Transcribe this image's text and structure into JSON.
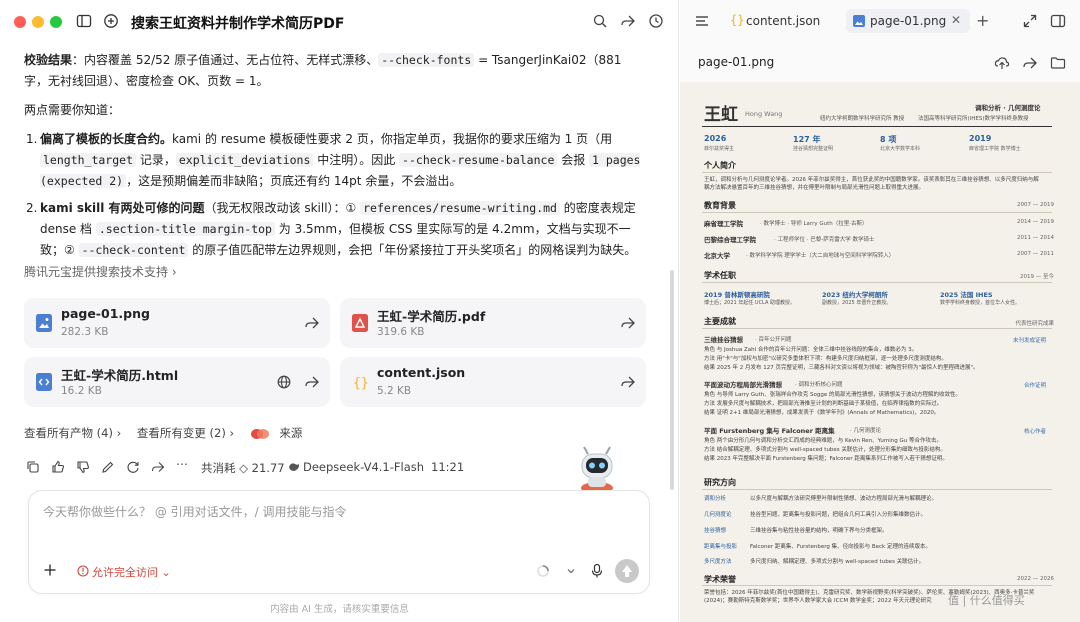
{
  "window": {
    "title": "搜索王虹资料并制作学术简历PDF"
  },
  "chat": {
    "verify_label": "校验结果",
    "verify_text_1": "：内容覆盖 52/52 原子值通过、无占位符、无样式漂移、",
    "verify_code": "--check-fonts",
    "verify_text_2": " = TsangerJinKai02（881 字，无衬线回退）、密度检查 OK、页数 = 1。",
    "intro": "两点需要你知道：",
    "item1_num": "1.",
    "item1_title": "偏离了模板的长度合约。",
    "item1_a": "kami 的 resume 模板硬性要求 2 页，你指定单页，我据你的要求压缩为 1 页（用",
    "item1_code1": "length_target",
    "item1_b": " 记录，",
    "item1_code2": "explicit_deviations",
    "item1_c": " 中注明）。因此 ",
    "item1_code3": "--check-resume-balance",
    "item1_d": " 会报 ",
    "item1_code4": "1 pages (expected 2)",
    "item1_e": "，这是预期偏差而非缺陷；页底还有约 14pt 余量，不会溢出。",
    "item2_num": "2.",
    "item2_title": "kami skill 有两处可修的问题",
    "item2_a": "（我无权限改动该 skill）：① ",
    "item2_code1": "references/resume-writing.md",
    "item2_b": " 的密度表规定 dense 档 ",
    "item2_code2": ".section-title margin-top",
    "item2_c": " 为 3.5mm，但模板 CSS 里实际写的是 4.2mm，文档与实现不一致；② ",
    "item2_code3": "--check-content",
    "item2_d": " 的原子值匹配带左边界规则，会把「年份紧接拉丁开头奖项名」的网格误判为缺失。",
    "source": "腾讯元宝提供搜索技术支持 ›"
  },
  "files": [
    {
      "name": "page-01.png",
      "size": "282.3 KB",
      "icon": "image-icon",
      "color": "#4a7fd4"
    },
    {
      "name": "王虹-学术简历.pdf",
      "size": "319.6 KB",
      "icon": "pdf-icon",
      "color": "#e0534a"
    },
    {
      "name": "王虹-学术简历.html",
      "size": "16.2 KB",
      "icon": "html-icon",
      "color": "#4a7fd4"
    },
    {
      "name": "content.json",
      "size": "5.2 KB",
      "icon": "json-icon",
      "color": "#f0b429"
    }
  ],
  "links": {
    "all_outputs": "查看所有产物 (4) ›",
    "all_changes": "查看所有变更 (2) ›",
    "source": "来源"
  },
  "meta": {
    "cost_label": "共消耗 ◇ 21.77",
    "model": "Deepseek-V4.1-Flash",
    "time": "11:21"
  },
  "composer": {
    "placeholder": "今天帮你做些什么？ @ 引用对话文件，/ 调用技能与指令",
    "permission": "允许完全访问 ⌄"
  },
  "footer": "内容由 AI 生成，请核实重要信息",
  "right": {
    "tabs": [
      {
        "label": "content.json",
        "active": false
      },
      {
        "label": "page-01.png",
        "active": true
      }
    ],
    "preview_file": "page-01.png"
  },
  "resume": {
    "name": "王虹",
    "name_en": "Hong Wang",
    "affil_1": "纽约大学柯朗数学科学研究所 教授",
    "affil_2": "法国高等科学研究所(IHES)数学学科终身教授",
    "field": "调和分析 · 几何测度论",
    "stats": [
      {
        "v": "2026",
        "l": "菲尔兹奖得主"
      },
      {
        "v": "127 年",
        "l": "挂谷猜想完整证明"
      },
      {
        "v": "8 项",
        "l": "北京大学数学本科"
      },
      {
        "v": "2019",
        "l": "麻省理工学院 数学博士"
      }
    ],
    "sec_intro": "个人简介",
    "intro": "王虹，调和分析与几何测度论学者。2026 年菲尔兹奖得主，首位获此奖的中国籍数学家。该奖表彰其在三维挂谷猜想、以多尺度归纳与解耦方法解决悬置百年的三维挂谷猜想，并在傅里叶限制与局部光滑性问题上取得重大进展。",
    "sec_edu": "教育背景",
    "edu_date": "2007 — 2019",
    "edu": [
      {
        "s": "麻省理工学院",
        "d": "· 数学博士 · 导师 Larry Guth（拉里·古斯）",
        "y": "2014 — 2019"
      },
      {
        "s": "巴黎综合理工学院",
        "d": "· 工程师学位 · 巴黎-萨克雷大学 数学硕士",
        "y": "2011 — 2014"
      },
      {
        "s": "北京大学",
        "d": "· 数学科学学院 理学学士（大二自地球与空间科学学院转入）",
        "y": "2007 — 2011"
      }
    ],
    "sec_pos": "学术任职",
    "pos_date": "2019 — 至今",
    "pos": [
      {
        "y": "2019 普林斯顿高研院",
        "d": "博士后；2021 年起任 UCLA 助理教授。"
      },
      {
        "y": "2023 纽约大学柯朗所",
        "d": "副教授，2025 年晋升正教授。"
      },
      {
        "y": "2025 法国 IHES",
        "d": "数学学科终身教授，首位华人女性。"
      }
    ],
    "sec_ach": "主要成就",
    "ach_note": "代表性研究成果",
    "ach": [
      {
        "t": "三维挂谷猜想",
        "s": "· 百年公开问题",
        "tag": "未刊发成证明",
        "lines": [
          "角色   与 Joshua Zahl 合作的百年公开问题：全体三维中挂谷线段的集合，维数必为 3。",
          "方法   用\"卡\"与\"加权与加密\"以研究多重体积下项：构建多尺度归纳框架，逐一处理多尺度测度结构。",
          "结果   2025 年 2 月发布 127 页完整证明，三藏各科对文资以将视为领域：被陶哲轩称为\"最惊人的里程碑进展\"。"
        ]
      },
      {
        "t": "平面波动方程局部光滑猜想",
        "s": "· 调和分析核心问题",
        "tag": "合作证明",
        "lines": [
          "角色   与导师 Larry Guth、张瑞祥合作攻克 Sogge 的局部光滑性猜想，该猜想关于波动方程解的收敛性。",
          "方法   发展多尺度与解耦技术，把局部光滑推至计划的判断基础于某极值，在临界律指数的实际过。",
          "结果   证明 2+1 维局部光滑猜想，成果发表于《数学年刊》(Annals of Mathematics)，2020。"
        ]
      },
      {
        "t": "平面 Furstenberg 集与 Falconer 距离集",
        "s": "· 几何测度论",
        "tag": "核心作者",
        "lines": [
          "角色   两个由分形几何与调和分析交汇而成的经典难题，与 Kevin Ren、Yuming Gu 等合作攻击。",
          "方法   结合解耦定理、多项式分割与 well-spaced tubes 关联估计，处理分形集的细致与投影结构。",
          "结果   2023 年完整解决平面 Furstenberg 集问题；Falconer 距离集系列工作被写入若干猜想证明。"
        ]
      }
    ],
    "sec_dir": "研究方向",
    "dir": [
      {
        "k": "调和分析",
        "v": "以多尺度与解耦方法研究傅里叶限制性猜想、波动方程局部光滑与解耦理论。"
      },
      {
        "k": "几何测度论",
        "v": "挂谷型问题、距离集与投影问题，把组合几何工具引入分形集维数估计。"
      },
      {
        "k": "挂谷猜想",
        "v": "三维挂谷集与粘性挂谷量的结构，明确下界与分类框架。"
      },
      {
        "k": "距离集与投影",
        "v": "Falconer 距离集、Furstenberg 集、径向投影与 Beck 定理的连续版本。"
      },
      {
        "k": "多尺度方法",
        "v": "多尺度归纳、解耦定理、多项式分割与 well-spaced tubes 关联估计。"
      }
    ],
    "sec_hon": "学术荣誉",
    "hon_date": "2022 — 2026",
    "hon": "荣誉包括：2026 年菲尔兹奖(首位中国籍得主)、克雷研究奖、数学新视野奖(科学突破奖)、萨伦奖、塞勒姆奖(2023)、西奥多·卡普兰奖(2024)；赛勒斯特克斯数学奖；世界华人数学家大会 ICCM 数学金奖；2022 年天元理论研究"
  },
  "watermark": "值 | 什么值得买"
}
